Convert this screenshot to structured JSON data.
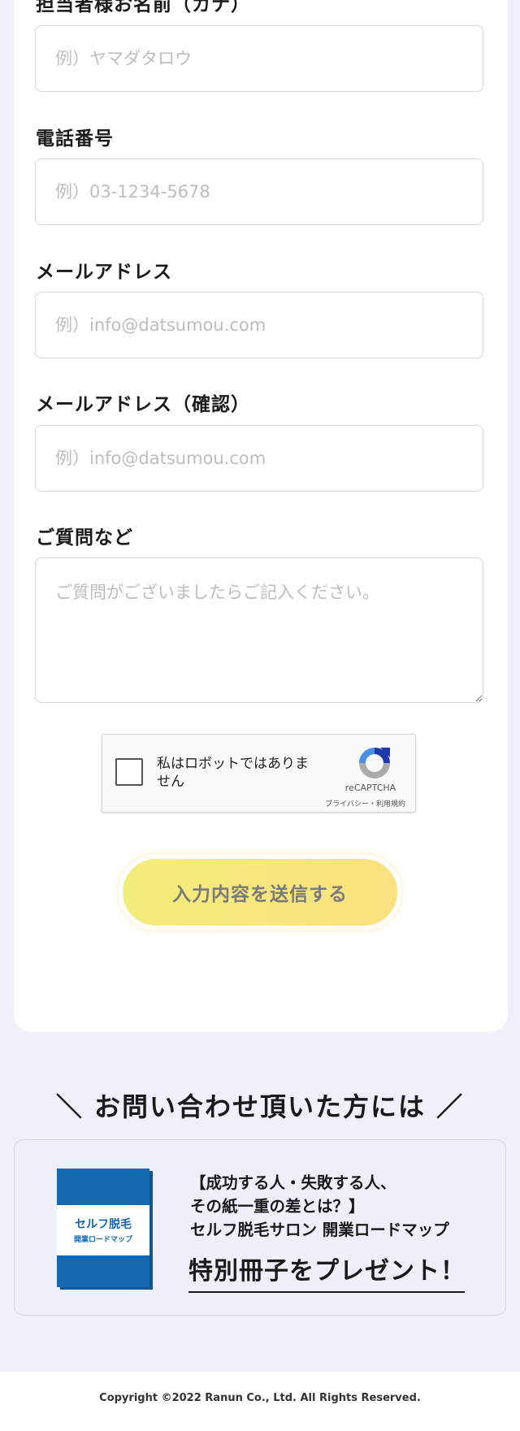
{
  "form": {
    "name_kana": {
      "label": "担当者様お名前（カナ）",
      "placeholder": "例）ヤマダタロウ",
      "value": ""
    },
    "phone": {
      "label": "電話番号",
      "placeholder": "例）03-1234-5678",
      "value": ""
    },
    "email": {
      "label": "メールアドレス",
      "placeholder": "例）info@datsumou.com",
      "value": ""
    },
    "email_confirm": {
      "label": "メールアドレス（確認）",
      "placeholder": "例）info@datsumou.com",
      "value": ""
    },
    "questions": {
      "label": "ご質問など",
      "placeholder": "ご質問がございましたらご記入ください。",
      "value": ""
    }
  },
  "recaptcha": {
    "checkbox_label": "私はロボットではありません",
    "brand": "reCAPTCHA",
    "links": "プライバシー・利用規約",
    "checked": false
  },
  "submit_label": "入力内容を送信する",
  "present": {
    "heading": "＼ お問い合わせ頂いた方には ／",
    "booklet_title": "セルフ脱毛",
    "booklet_subtitle": "開業ロードマップ",
    "line1": "【成功する人・失敗する人、",
    "line2": "その紙一重の差とは？】",
    "line3": "セルフ脱毛サロン 開業ロードマップ",
    "line4": "特別冊子をプレゼント！"
  },
  "footer": {
    "copyright": "Copyright ©2022 Ranun Co., Ltd. All Rights Reserved."
  },
  "colors": {
    "page_bg": "#eef0fb",
    "card_bg": "#ffffff",
    "button_gradient_start": "#f3ee7a",
    "button_gradient_end": "#fbe07f",
    "booklet_blue": "#1468b0"
  }
}
